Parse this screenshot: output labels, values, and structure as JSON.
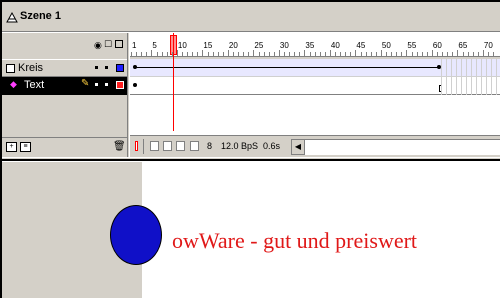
{
  "scene": {
    "title": "Szene 1",
    "icon": "scene-icon"
  },
  "timeline": {
    "header_icons": [
      "eye-icon",
      "lock-icon",
      "outline-icon"
    ],
    "ruler_numbers": [
      "1",
      "5",
      "10",
      "15",
      "20",
      "25",
      "30",
      "35",
      "40",
      "45",
      "50",
      "55",
      "60",
      "65",
      "70"
    ],
    "current_frame": 8,
    "layers": [
      {
        "name": "Kreis",
        "icon": "layer-icon",
        "outline_color": "#2020ff",
        "selected": false
      },
      {
        "name": "Text",
        "icon": "text-layer-icon",
        "outline_color": "#ff2020",
        "selected": true
      }
    ],
    "footer": {
      "frame_number": "8",
      "frame_rate": "12.0 BpS",
      "elapsed": "0.6s"
    }
  },
  "stage": {
    "text": "owWare - gut und preiswert",
    "text_color": "#e01818",
    "circle_color": "#1010c8"
  }
}
